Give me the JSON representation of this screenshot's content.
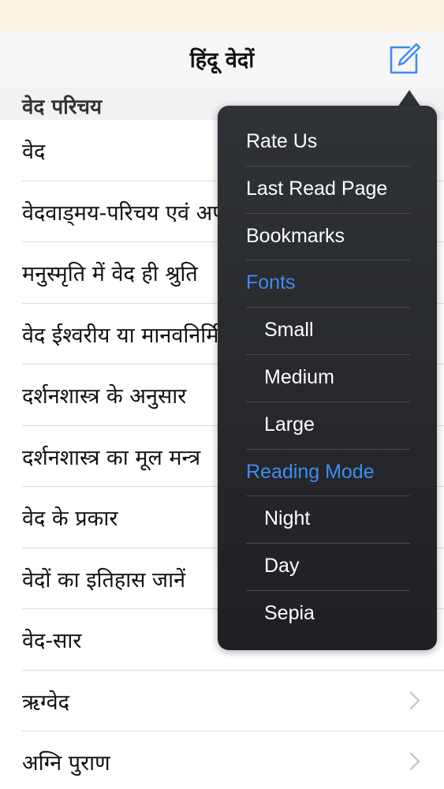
{
  "app": {
    "title": "हिंदू वेदों"
  },
  "section": {
    "header": "वेद परिचय"
  },
  "list": {
    "items": [
      {
        "label": "वेद"
      },
      {
        "label": "वेदवाड्मय-परिचय एवं अपौरुषेयता"
      },
      {
        "label": "मनुस्मृति में वेद ही श्रुति"
      },
      {
        "label": "वेद ईश्वरीय या मानवनिर्मित"
      },
      {
        "label": "दर्शनशास्त्र के अनुसार"
      },
      {
        "label": "दर्शनशास्त्र का मूल मन्त्र"
      },
      {
        "label": "वेद के प्रकार"
      },
      {
        "label": "वेदों का इतिहास जानें"
      },
      {
        "label": "वेद-सार"
      },
      {
        "label": "ऋग्वेद"
      },
      {
        "label": "अग्नि पुराण"
      }
    ]
  },
  "menu": {
    "rate_us": "Rate Us",
    "last_read_page": "Last Read Page",
    "bookmarks": "Bookmarks",
    "fonts_heading": "Fonts",
    "font_small": "Small",
    "font_medium": "Medium",
    "font_large": "Large",
    "reading_mode_heading": "Reading Mode",
    "mode_night": "Night",
    "mode_day": "Day",
    "mode_sepia": "Sepia"
  },
  "icons": {
    "compose": "compose-icon",
    "chevron": "chevron-right-icon"
  },
  "colors": {
    "accent": "#3d8cf0",
    "popover_bg": "#2a2c30",
    "status_bar_bg": "#fbf4e6",
    "chevron": "#c7c7cc"
  }
}
